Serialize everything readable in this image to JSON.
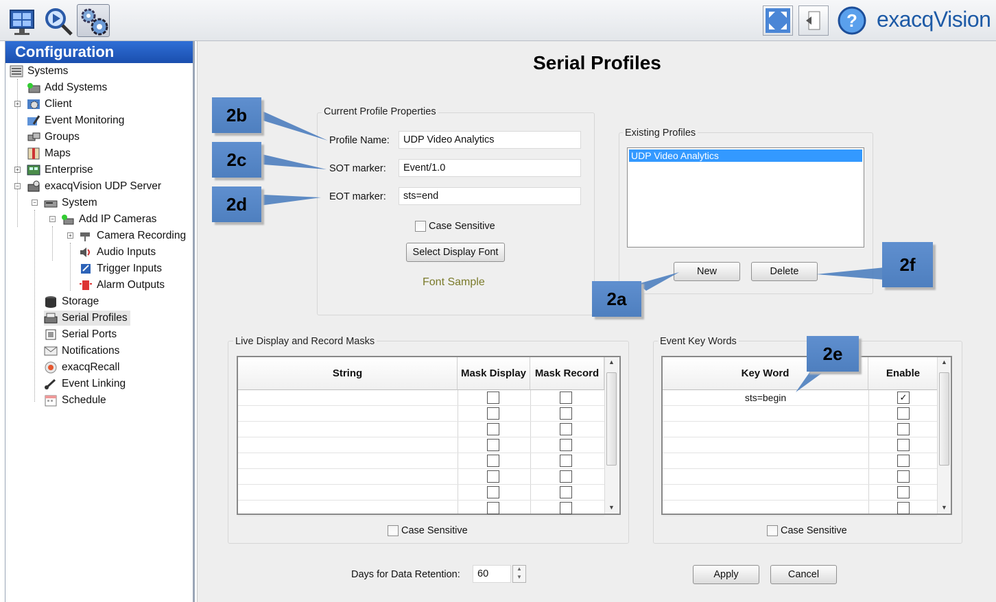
{
  "app": {
    "brand": "exacqVision"
  },
  "sidebar": {
    "title": "Configuration",
    "items": [
      {
        "label": "Systems"
      },
      {
        "label": "Add Systems"
      },
      {
        "label": "Client"
      },
      {
        "label": "Event Monitoring"
      },
      {
        "label": "Groups"
      },
      {
        "label": "Maps"
      },
      {
        "label": "Enterprise"
      },
      {
        "label": "exacqVision UDP Server"
      },
      {
        "label": "System"
      },
      {
        "label": "Add IP Cameras"
      },
      {
        "label": "Camera Recording"
      },
      {
        "label": "Audio Inputs"
      },
      {
        "label": "Trigger Inputs"
      },
      {
        "label": "Alarm Outputs"
      },
      {
        "label": "Storage"
      },
      {
        "label": "Serial Profiles"
      },
      {
        "label": "Serial Ports"
      },
      {
        "label": "Notifications"
      },
      {
        "label": "exacqRecall"
      },
      {
        "label": "Event Linking"
      },
      {
        "label": "Schedule"
      }
    ],
    "selected": "Serial Profiles"
  },
  "main": {
    "title": "Serial Profiles",
    "current_profile": {
      "group_title": "Current Profile Properties",
      "profile_name_label": "Profile Name:",
      "profile_name_value": "UDP Video Analytics",
      "sot_label": "SOT marker:",
      "sot_value": "Event/1.0",
      "eot_label": "EOT marker:",
      "eot_value": "sts=end",
      "case_sensitive_label": "Case Sensitive",
      "case_sensitive_checked": false,
      "select_font_label": "Select Display Font",
      "font_sample": "Font Sample"
    },
    "existing_profiles": {
      "group_title": "Existing Profiles",
      "items": [
        "UDP Video Analytics"
      ],
      "new_label": "New",
      "delete_label": "Delete"
    },
    "masks": {
      "group_title": "Live Display and Record Masks",
      "columns": [
        "String",
        "Mask Display",
        "Mask Record"
      ],
      "rows": [
        {
          "string": "",
          "display": false,
          "record": false
        },
        {
          "string": "",
          "display": false,
          "record": false
        },
        {
          "string": "",
          "display": false,
          "record": false
        },
        {
          "string": "",
          "display": false,
          "record": false
        },
        {
          "string": "",
          "display": false,
          "record": false
        },
        {
          "string": "",
          "display": false,
          "record": false
        },
        {
          "string": "",
          "display": false,
          "record": false
        },
        {
          "string": "",
          "display": false,
          "record": false
        }
      ],
      "case_sensitive_label": "Case Sensitive"
    },
    "keywords": {
      "group_title": "Event Key Words",
      "columns": [
        "Key Word",
        "Enable"
      ],
      "rows": [
        {
          "keyword": "sts=begin",
          "enable": true
        },
        {
          "keyword": "",
          "enable": false
        },
        {
          "keyword": "",
          "enable": false
        },
        {
          "keyword": "",
          "enable": false
        },
        {
          "keyword": "",
          "enable": false
        },
        {
          "keyword": "",
          "enable": false
        },
        {
          "keyword": "",
          "enable": false
        },
        {
          "keyword": "",
          "enable": false
        }
      ],
      "case_sensitive_label": "Case Sensitive"
    },
    "retention": {
      "label": "Days for Data Retention:",
      "value": "60"
    },
    "apply_label": "Apply",
    "cancel_label": "Cancel"
  },
  "callouts": [
    "2a",
    "2b",
    "2c",
    "2d",
    "2e",
    "2f"
  ],
  "colors": {
    "callout": "#5585c6",
    "accent": "#1a4fae",
    "selection": "#3399ff",
    "font_sample": "#7a7a2a"
  }
}
